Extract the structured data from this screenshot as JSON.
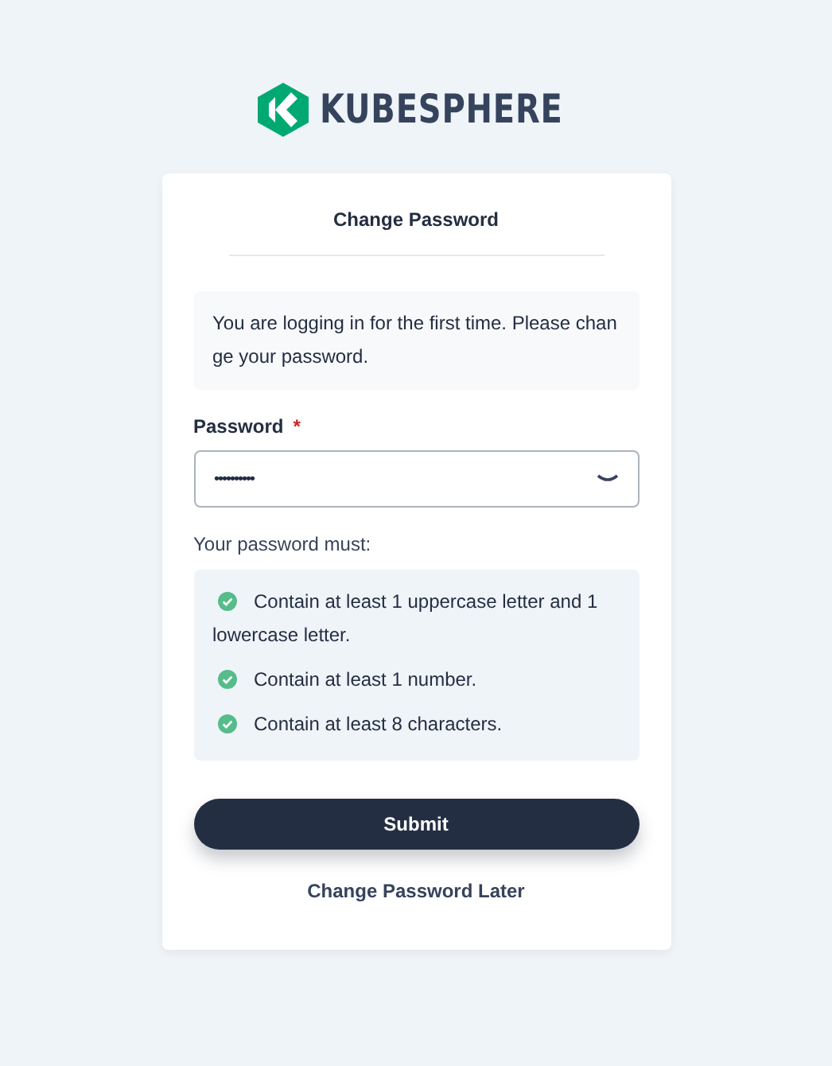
{
  "logo": {
    "text": "KUBESPHERE"
  },
  "card": {
    "title": "Change Password",
    "notice": "You are logging in for the first time. Please change your password.",
    "password": {
      "label": "Password",
      "required_mark": "*",
      "value": "••••••••••"
    },
    "rules_heading": "Your password must:",
    "rules": [
      {
        "text": "Contain at least 1 uppercase letter and 1 lowercase letter.",
        "met": true
      },
      {
        "text": "Contain at least 1 number.",
        "met": true
      },
      {
        "text": "Contain at least 8 characters.",
        "met": true
      }
    ],
    "submit": "Submit",
    "later": "Change Password Later"
  }
}
